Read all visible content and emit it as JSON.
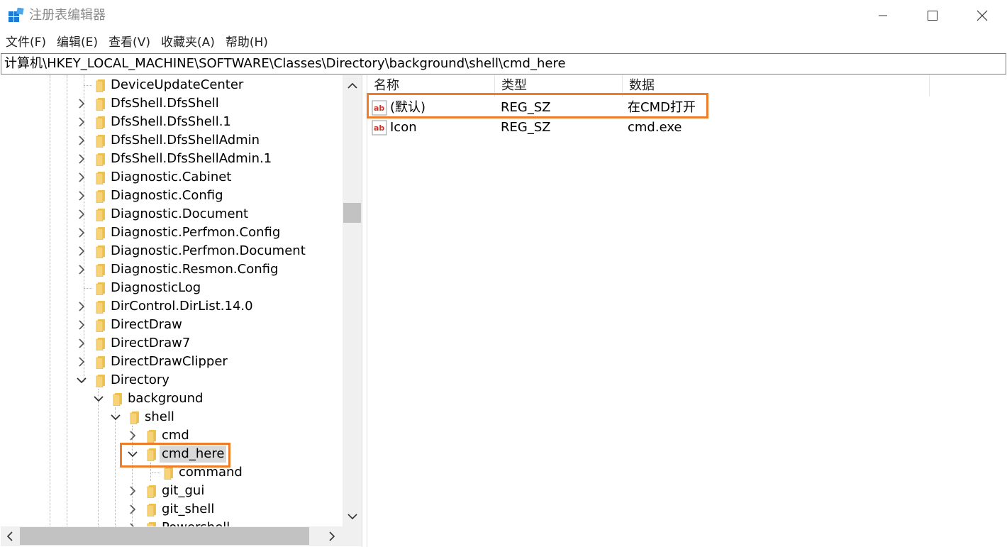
{
  "window": {
    "title": "注册表编辑器",
    "controls": {
      "minimize": "minimize",
      "maximize": "maximize",
      "close": "close"
    }
  },
  "menu": [
    {
      "label": "文件(F)"
    },
    {
      "label": "编辑(E)"
    },
    {
      "label": "查看(V)"
    },
    {
      "label": "收藏夹(A)"
    },
    {
      "label": "帮助(H)"
    }
  ],
  "address": "计算机\\HKEY_LOCAL_MACHINE\\SOFTWARE\\Classes\\Directory\\background\\shell\\cmd_here",
  "tree": [
    {
      "label": "DeviceUpdateCenter",
      "level": 0,
      "expander": "none"
    },
    {
      "label": "DfsShell.DfsShell",
      "level": 0,
      "expander": "collapsed"
    },
    {
      "label": "DfsShell.DfsShell.1",
      "level": 0,
      "expander": "collapsed"
    },
    {
      "label": "DfsShell.DfsShellAdmin",
      "level": 0,
      "expander": "collapsed"
    },
    {
      "label": "DfsShell.DfsShellAdmin.1",
      "level": 0,
      "expander": "collapsed"
    },
    {
      "label": "Diagnostic.Cabinet",
      "level": 0,
      "expander": "collapsed"
    },
    {
      "label": "Diagnostic.Config",
      "level": 0,
      "expander": "collapsed"
    },
    {
      "label": "Diagnostic.Document",
      "level": 0,
      "expander": "collapsed"
    },
    {
      "label": "Diagnostic.Perfmon.Config",
      "level": 0,
      "expander": "collapsed"
    },
    {
      "label": "Diagnostic.Perfmon.Document",
      "level": 0,
      "expander": "collapsed"
    },
    {
      "label": "Diagnostic.Resmon.Config",
      "level": 0,
      "expander": "collapsed"
    },
    {
      "label": "DiagnosticLog",
      "level": 0,
      "expander": "none"
    },
    {
      "label": "DirControl.DirList.14.0",
      "level": 0,
      "expander": "collapsed"
    },
    {
      "label": "DirectDraw",
      "level": 0,
      "expander": "collapsed"
    },
    {
      "label": "DirectDraw7",
      "level": 0,
      "expander": "collapsed"
    },
    {
      "label": "DirectDrawClipper",
      "level": 0,
      "expander": "collapsed"
    },
    {
      "label": "Directory",
      "level": 0,
      "expander": "expanded"
    },
    {
      "label": "background",
      "level": 1,
      "expander": "expanded"
    },
    {
      "label": "shell",
      "level": 2,
      "expander": "expanded"
    },
    {
      "label": "cmd",
      "level": 3,
      "expander": "collapsed"
    },
    {
      "label": "cmd_here",
      "level": 3,
      "expander": "expanded",
      "selected": true
    },
    {
      "label": "command",
      "level": 4,
      "expander": "none"
    },
    {
      "label": "git_gui",
      "level": 3,
      "expander": "collapsed"
    },
    {
      "label": "git_shell",
      "level": 3,
      "expander": "collapsed"
    },
    {
      "label": "Powershell",
      "level": 3,
      "expander": "collapsed"
    }
  ],
  "values": {
    "columns": [
      "名称",
      "类型",
      "数据"
    ],
    "rows": [
      {
        "name": "(默认)",
        "type": "REG_SZ",
        "data": "在CMD打开",
        "icon": "string-value-icon",
        "highlighted": true
      },
      {
        "name": "Icon",
        "type": "REG_SZ",
        "data": "cmd.exe",
        "icon": "string-value-icon",
        "highlighted": false
      }
    ]
  },
  "colors": {
    "highlight": "#ee7d2b",
    "folder": "#f2c44c",
    "selection": "#d9d9d9",
    "app_icon": "#1e7bd4"
  }
}
